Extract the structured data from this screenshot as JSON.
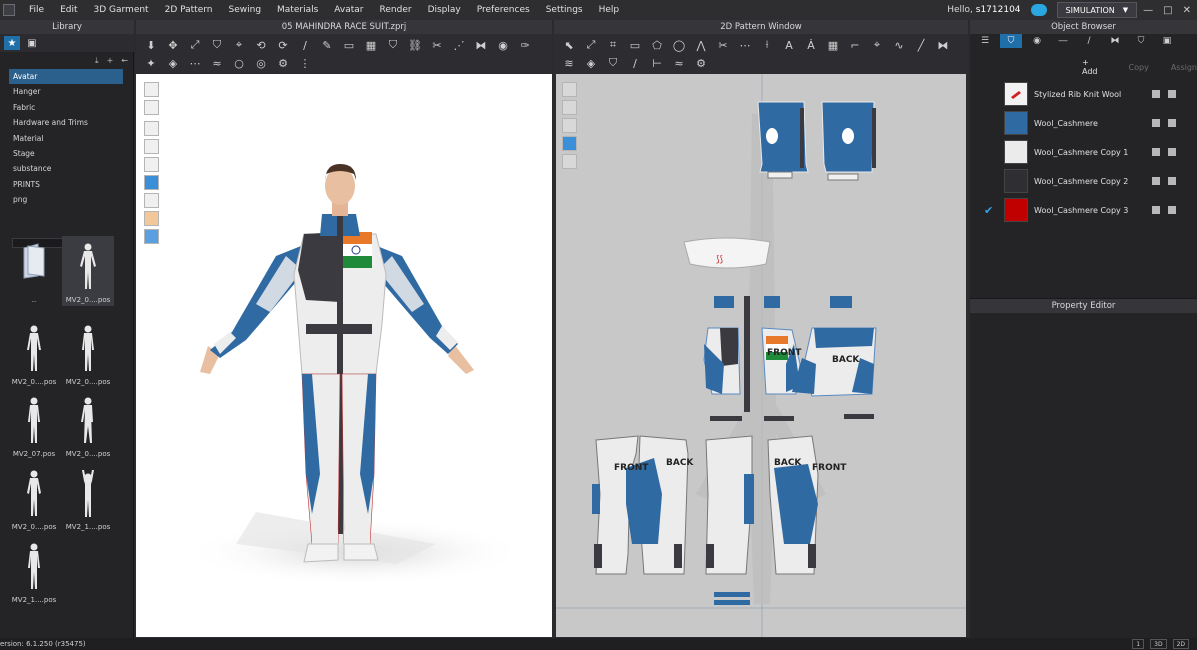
{
  "menu": {
    "items": [
      "File",
      "Edit",
      "3D Garment",
      "2D Pattern",
      "Sewing",
      "Materials",
      "Avatar",
      "Render",
      "Display",
      "Preferences",
      "Settings",
      "Help"
    ],
    "greeting": "Hello,",
    "username": "s1712104",
    "simulation_label": "SIMULATION",
    "window_controls": [
      "—",
      "□",
      "✕"
    ]
  },
  "library": {
    "title": "Library",
    "tree": [
      "Avatar",
      "Hanger",
      "Fabric",
      "Hardware and Trims",
      "Material",
      "Stage",
      "substance",
      "PRINTS",
      "png"
    ],
    "selected_tree": "Avatar",
    "thumbnails": [
      {
        "label": "..",
        "kind": "folder"
      },
      {
        "label": "MV2_0....pos",
        "kind": "avatar"
      },
      {
        "label": "MV2_0....pos",
        "kind": "avatar"
      },
      {
        "label": "MV2_0....pos",
        "kind": "avatar"
      },
      {
        "label": "MV2_07.pos",
        "kind": "avatar"
      },
      {
        "label": "MV2_0....pos",
        "kind": "avatar"
      },
      {
        "label": "MV2_0....pos",
        "kind": "avatar"
      },
      {
        "label": "MV2_1....pos",
        "kind": "avatar"
      },
      {
        "label": "MV2_1....pos",
        "kind": "avatar"
      }
    ]
  },
  "viewport3d": {
    "title": "05 MAHINDRA RACE SUIT.zprj"
  },
  "viewport2d": {
    "title": "2D Pattern Window",
    "labels": {
      "front_top": "FRONT",
      "back_top": "BACK",
      "front_left": "FRONT",
      "back_left": "BACK",
      "back_right": "BACK",
      "front_right": "FRONT"
    }
  },
  "object_browser": {
    "title": "Object Browser",
    "add_label": "+ Add",
    "copy_label": "Copy",
    "assign_label": "Assign",
    "materials": [
      {
        "name": "Stylized Rib Knit Wool",
        "color": "#f2f2f2",
        "checked": false
      },
      {
        "name": "Wool_Cashmere",
        "color": "#2f6aa3",
        "checked": false
      },
      {
        "name": "Wool_Cashmere Copy 1",
        "color": "#ebebeb",
        "checked": false
      },
      {
        "name": "Wool_Cashmere Copy 2",
        "color": "#2e2e33",
        "checked": false
      },
      {
        "name": "Wool_Cashmere Copy 3",
        "color": "#c00000",
        "checked": true
      }
    ]
  },
  "property_editor": {
    "title": "Property Editor"
  },
  "status": {
    "version": "ersion: 6.1.250 (r35475)",
    "views": [
      "1",
      "3D",
      "2D"
    ]
  },
  "colors": {
    "accent": "#1f6fa8",
    "suit_blue": "#2f6aa3",
    "suit_white": "#ececec",
    "suit_dark": "#3a3a40",
    "pattern_bg": "#c8c8c8"
  }
}
